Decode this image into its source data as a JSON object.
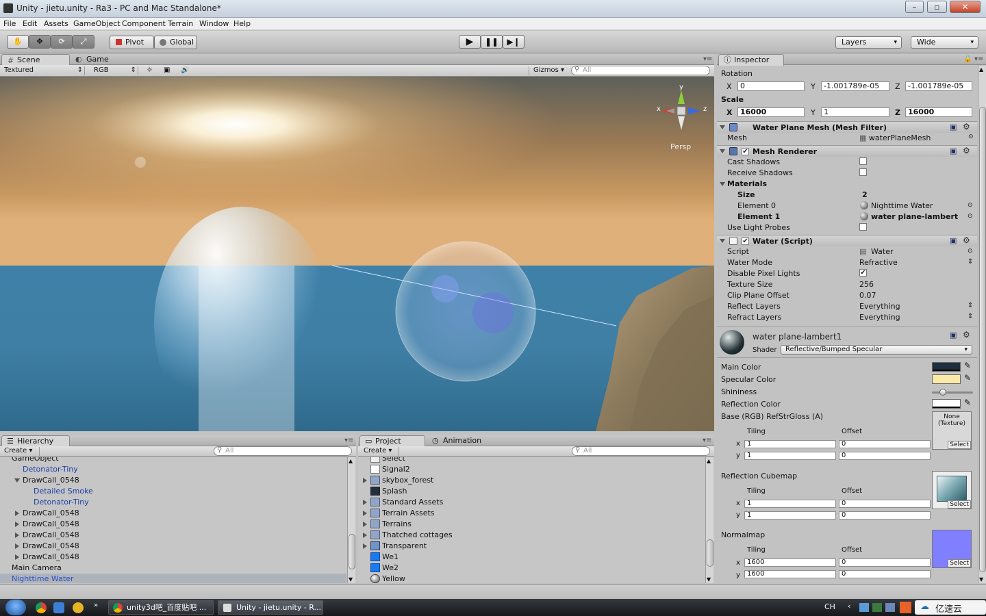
{
  "window": {
    "title": "Unity - jietu.unity - Ra3 - PC and Mac Standalone*"
  },
  "menu": [
    "File",
    "Edit",
    "Assets",
    "GameObject",
    "Component",
    "Terrain",
    "Window",
    "Help"
  ],
  "toolbar": {
    "pivot": "Pivot",
    "global": "Global",
    "layers": "Layers",
    "layout": "Wide"
  },
  "scene_panel": {
    "tabs": [
      "Scene",
      "Game"
    ],
    "render_mode": "Textured",
    "color_mode": "RGB",
    "gizmos": "Gizmos",
    "search_placeholder": "All",
    "gizmo": {
      "x": "x",
      "y": "y",
      "z": "z",
      "projection": "Persp"
    }
  },
  "hierarchy": {
    "tab": "Hierarchy",
    "create": "Create",
    "search_placeholder": "All",
    "items": [
      {
        "label": "GameObject",
        "indent": 1,
        "color": "#111111",
        "arrow": ""
      },
      {
        "label": "Detonator-Tiny",
        "indent": 2,
        "color": "#1b3ea3",
        "arrow": ""
      },
      {
        "label": "DrawCall_0548",
        "indent": 2,
        "color": "#111111",
        "arrow": "d"
      },
      {
        "label": "Detailed Smoke",
        "indent": 3,
        "color": "#1b3ea3",
        "arrow": ""
      },
      {
        "label": "Detonator-Tiny",
        "indent": 3,
        "color": "#1b3ea3",
        "arrow": ""
      },
      {
        "label": "DrawCall_0548",
        "indent": 2,
        "color": "#111111",
        "arrow": "r"
      },
      {
        "label": "DrawCall_0548",
        "indent": 2,
        "color": "#111111",
        "arrow": "r"
      },
      {
        "label": "DrawCall_0548",
        "indent": 2,
        "color": "#111111",
        "arrow": "r"
      },
      {
        "label": "DrawCall_0548",
        "indent": 2,
        "color": "#111111",
        "arrow": "r"
      },
      {
        "label": "DrawCall_0548",
        "indent": 2,
        "color": "#111111",
        "arrow": "r"
      },
      {
        "label": "Main Camera",
        "indent": 1,
        "color": "#111111",
        "arrow": ""
      },
      {
        "label": "Nighttime Water",
        "indent": 1,
        "color": "#2b4fc8",
        "arrow": "",
        "selected": true
      }
    ]
  },
  "project": {
    "tabs": [
      "Project",
      "Animation"
    ],
    "create": "Create",
    "search_placeholder": "All",
    "items": [
      {
        "label": "Select",
        "icon": "file",
        "arrow": false
      },
      {
        "label": "Signal2",
        "icon": "shader",
        "arrow": false
      },
      {
        "label": "skybox_forest",
        "icon": "folder",
        "arrow": true
      },
      {
        "label": "Splash",
        "icon": "texture",
        "arrow": false
      },
      {
        "label": "Standard Assets",
        "icon": "folder",
        "arrow": true
      },
      {
        "label": "Terrain Assets",
        "icon": "folder",
        "arrow": true
      },
      {
        "label": "Terrains",
        "icon": "folder",
        "arrow": true
      },
      {
        "label": "Thatched cottages",
        "icon": "folder",
        "arrow": true
      },
      {
        "label": "Transparent",
        "icon": "prefab",
        "arrow": true
      },
      {
        "label": "We1",
        "icon": "blue",
        "arrow": false
      },
      {
        "label": "We2",
        "icon": "blue",
        "arrow": false
      },
      {
        "label": "Yellow",
        "icon": "sphere",
        "arrow": false
      }
    ]
  },
  "inspector": {
    "tab": "Inspector",
    "rotation_label": "Rotation",
    "rotation": {
      "x": "0",
      "y": "-1.001789e-05",
      "z": "-1.001789e-05"
    },
    "scale_label": "Scale",
    "scale": {
      "x": "16000",
      "y": "1",
      "z": "16000"
    },
    "axis": {
      "x": "X",
      "y": "Y",
      "z": "Z"
    },
    "mesh_filter": {
      "title": "Water Plane Mesh (Mesh Filter)",
      "mesh_label": "Mesh",
      "mesh_value": "waterPlaneMesh"
    },
    "mesh_renderer": {
      "title": "Mesh Renderer",
      "cast_shadows": "Cast Shadows",
      "receive_shadows": "Receive Shadows",
      "materials": "Materials",
      "size_label": "Size",
      "size_value": "2",
      "element0_label": "Element 0",
      "element0_value": "Nighttime Water",
      "element1_label": "Element 1",
      "element1_value": "water plane-lambert",
      "light_probes": "Use Light Probes"
    },
    "water_script": {
      "title": "Water (Script)",
      "rows": [
        {
          "label": "Script",
          "value": "Water"
        },
        {
          "label": "Water Mode",
          "value": "Refractive"
        },
        {
          "label": "Disable Pixel Lights",
          "value": ""
        },
        {
          "label": "Texture Size",
          "value": "256"
        },
        {
          "label": "Clip Plane Offset",
          "value": "0.07"
        },
        {
          "label": "Reflect Layers",
          "value": "Everything"
        },
        {
          "label": "Refract Layers",
          "value": "Everything"
        }
      ]
    },
    "material": {
      "name": "water plane-lambert1",
      "shader_label": "Shader",
      "shader": "Reflective/Bumped Specular",
      "main_color": "Main Color",
      "specular_color": "Specular Color",
      "shininess": "Shininess",
      "shininess_value": 0.05,
      "reflection_color": "Reflection Color",
      "base_tex": "Base (RGB) RefStrGloss (A)",
      "base_none": "None",
      "base_type": "(Texture)",
      "tiling": "Tiling",
      "offset": "Offset",
      "select": "Select",
      "base_tiling": {
        "x": "1",
        "y": "1"
      },
      "base_offset": {
        "x": "0",
        "y": "0"
      },
      "cubemap": "Reflection Cubemap",
      "cube_tiling": {
        "x": "1",
        "y": "1"
      },
      "cube_offset": {
        "x": "0",
        "y": "0"
      },
      "normalmap": "Normalmap",
      "normal_tiling": {
        "x": "1600",
        "y": "1600"
      },
      "normal_offset": {
        "x": "0",
        "y": "0"
      },
      "x": "x",
      "y": "y"
    },
    "colors": {
      "main": "#1d2f3c",
      "specular": "#fbe9a8",
      "reflection": "#ffffff"
    }
  },
  "taskbar": {
    "tasks": [
      "unity3d吧_百度贴吧 ...",
      "Unity - jietu.unity - R..."
    ],
    "lang": "CH",
    "watermark": "亿速云"
  }
}
